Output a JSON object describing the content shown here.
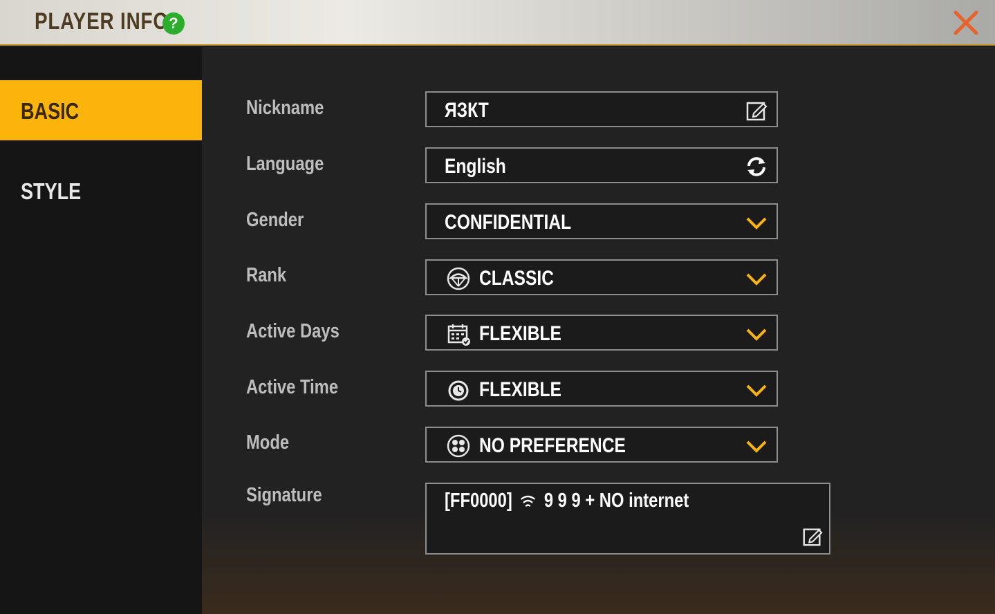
{
  "header": {
    "title": "PLAYER INFO",
    "help_icon": "?",
    "close_icon": "close-icon"
  },
  "sidebar": {
    "tabs": [
      {
        "label": "BASIC",
        "active": true
      },
      {
        "label": "STYLE",
        "active": false
      }
    ]
  },
  "form": {
    "nickname": {
      "label": "Nickname",
      "value": "ЯЗКТ",
      "icon": "edit-icon"
    },
    "language": {
      "label": "Language",
      "value": "English",
      "icon": "refresh-icon"
    },
    "gender": {
      "label": "Gender",
      "value": "CONFIDENTIAL",
      "icon": "chevron-down-icon"
    },
    "rank": {
      "label": "Rank",
      "value": "CLASSIC",
      "lead_icon": "parachute-icon"
    },
    "active_days": {
      "label": "Active Days",
      "value": "FLEXIBLE",
      "lead_icon": "calendar-icon"
    },
    "active_time": {
      "label": "Active Time",
      "value": "FLEXIBLE",
      "lead_icon": "clock-icon"
    },
    "mode": {
      "label": "Mode",
      "value": "NO PREFERENCE",
      "lead_icon": "squad-icon"
    },
    "signature": {
      "label": "Signature",
      "value_prefix": "[FF0000]",
      "value_suffix": "9 9 9 + NO internet",
      "icon": "edit-icon"
    }
  },
  "colors": {
    "accent": "#fbb40c",
    "close": "#e8622c",
    "help": "#2cae2c"
  }
}
